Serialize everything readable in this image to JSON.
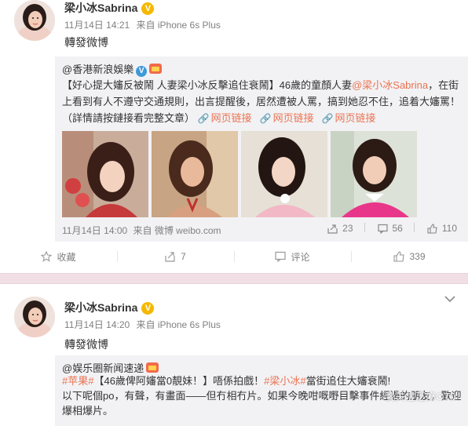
{
  "post1": {
    "username": "梁小冰Sabrina",
    "badge": "V",
    "time": "11月14日 14:21",
    "source": "来自 iPhone 6s Plus",
    "text": "轉發微博",
    "repost": {
      "author": "@香港新浪娛樂",
      "body_pre": "【好心提大嬸反被鬧 人妻梁小冰反擊追住衰鬧】46歲的童顏人妻",
      "mention": "@梁小冰Sabrina",
      "body_post": "，在街上看到有人不遵守交通規則，出言提醒後，居然遭被人罵，搞到她忍不住，追着大嬸罵！（詳情請按鏈接看完整文章）",
      "links": [
        "网页链接",
        "网页链接",
        "网页链接"
      ],
      "date": "11月14日 14:00",
      "source": "来自 微博 weibo.com",
      "stats": {
        "shares": "23",
        "comments": "56",
        "likes": "110"
      }
    },
    "actions": {
      "favorite": "收藏",
      "repost": "7",
      "comment": "评论",
      "like": "339"
    }
  },
  "post2": {
    "username": "梁小冰Sabrina",
    "badge": "V",
    "time": "11月14日 14:20",
    "source": "来自 iPhone 6s Plus",
    "text": "轉發微博",
    "repost": {
      "author": "@娱乐圈新闻速递",
      "tag1": "#苹果#",
      "line1_mid": "【46歲俾阿嬸當0靚妹！】唔係拍戲！",
      "tag2": "#梁小冰#",
      "line1_end": "當街追住大嬸衰鬧!",
      "line2": "以下呢個po，有聲，有畫面——但冇相冇片。如果今晚咁嘅嘢目擊事件經過的朋友，歡迎",
      "line3": "爆相爆片。",
      "watermark": "我关注芝麻OTV"
    }
  }
}
